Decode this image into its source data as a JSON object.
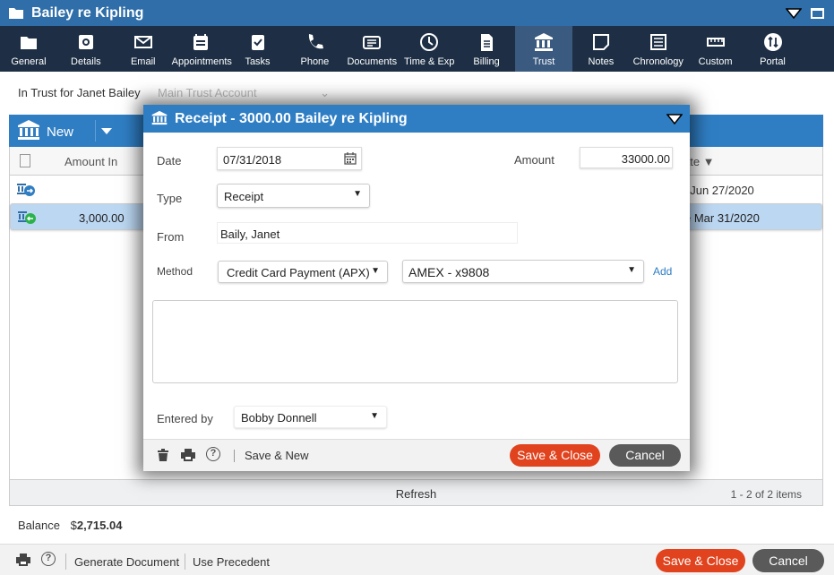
{
  "window": {
    "title": "Bailey re Kipling"
  },
  "tabs": [
    {
      "label": "General",
      "icon": "folder-icon"
    },
    {
      "label": "Details",
      "icon": "gear-icon"
    },
    {
      "label": "Email",
      "icon": "envelope-icon"
    },
    {
      "label": "Appointments",
      "icon": "calendar-icon"
    },
    {
      "label": "Tasks",
      "icon": "clipboard-check-icon"
    },
    {
      "label": "Phone",
      "icon": "phone-icon"
    },
    {
      "label": "Documents",
      "icon": "documents-icon"
    },
    {
      "label": "Time & Exp",
      "icon": "clock-icon"
    },
    {
      "label": "Billing",
      "icon": "invoice-icon"
    },
    {
      "label": "Trust",
      "icon": "bank-icon",
      "active": true
    },
    {
      "label": "Notes",
      "icon": "note-icon"
    },
    {
      "label": "Chronology",
      "icon": "list-icon"
    },
    {
      "label": "Custom",
      "icon": "ruler-icon"
    },
    {
      "label": "Portal",
      "icon": "portal-icon"
    }
  ],
  "trust": {
    "label": "In Trust for Janet Bailey",
    "account": "Main Trust Account"
  },
  "toolbar": {
    "new_label": "New"
  },
  "grid": {
    "col_amount_in": "Amount In",
    "col_date": "ate ▼",
    "rows": [
      {
        "amount": "",
        "date": "t Jun 27/2020",
        "type": "transfer-out"
      },
      {
        "amount": "3,000.00",
        "date": "e Mar 31/2020",
        "type": "receipt"
      }
    ],
    "refresh": "Refresh",
    "items": "1 - 2 of 2 items"
  },
  "balance": {
    "label": "Balance",
    "value_prefix": "$",
    "value": "2,715.04"
  },
  "bottom": {
    "generate": "Generate Document",
    "precedent": "Use Precedent",
    "save_close": "Save & Close",
    "cancel": "Cancel"
  },
  "dialog": {
    "title": "Receipt - 3000.00 Bailey re Kipling",
    "date_label": "Date",
    "date_value": "07/31/2018",
    "amount_label": "Amount",
    "amount_value": "33000.00",
    "type_label": "Type",
    "type_value": "Receipt",
    "from_label": "From",
    "from_value": "Baily, Janet",
    "method_label": "Method",
    "method_value": "Credit Card Payment (APX)",
    "card_value": "AMEX - x9808",
    "add_label": "Add",
    "notes_value": "",
    "entered_label": "Entered by",
    "entered_value": "Bobby Donnell",
    "save_new": "Save & New",
    "save_close": "Save & Close",
    "cancel": "Cancel"
  },
  "colors": {
    "accent": "#2f7ec4",
    "titlebar": "#2f6ea8",
    "tabbar": "#1e2f45",
    "primary_button": "#e0431e",
    "secondary_button": "#5a5a5a",
    "selected_row": "#bcd7f2"
  }
}
